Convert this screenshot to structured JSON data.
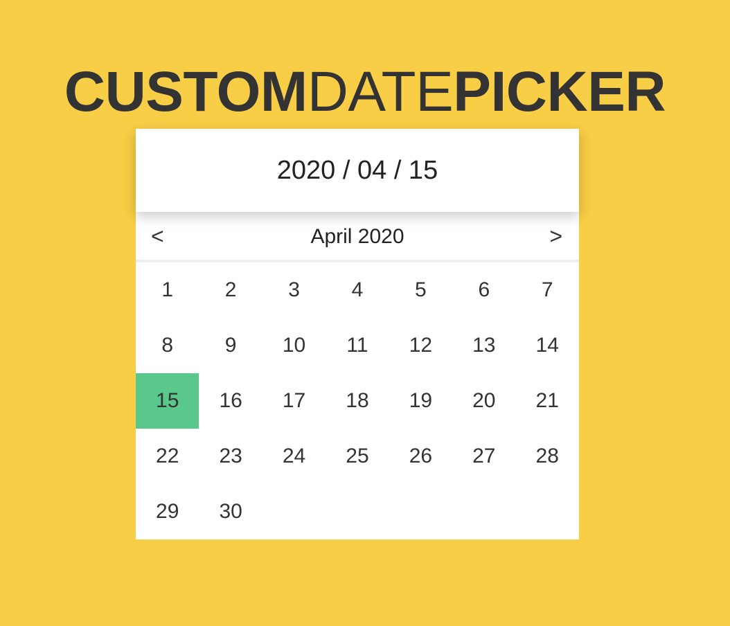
{
  "title": {
    "part1": "CUSTOM",
    "part2": "DATE",
    "part3": "PICKER"
  },
  "date_picker": {
    "selected_date": "2020 / 04 / 15",
    "month_label": "April 2020",
    "prev_label": "<",
    "next_label": ">",
    "days": [
      "1",
      "2",
      "3",
      "4",
      "5",
      "6",
      "7",
      "8",
      "9",
      "10",
      "11",
      "12",
      "13",
      "14",
      "15",
      "16",
      "17",
      "18",
      "19",
      "20",
      "21",
      "22",
      "23",
      "24",
      "25",
      "26",
      "27",
      "28",
      "29",
      "30"
    ],
    "selected_day": "15"
  },
  "colors": {
    "background": "#f8ce46",
    "selected_day": "#5ac88b",
    "text": "#333333"
  }
}
